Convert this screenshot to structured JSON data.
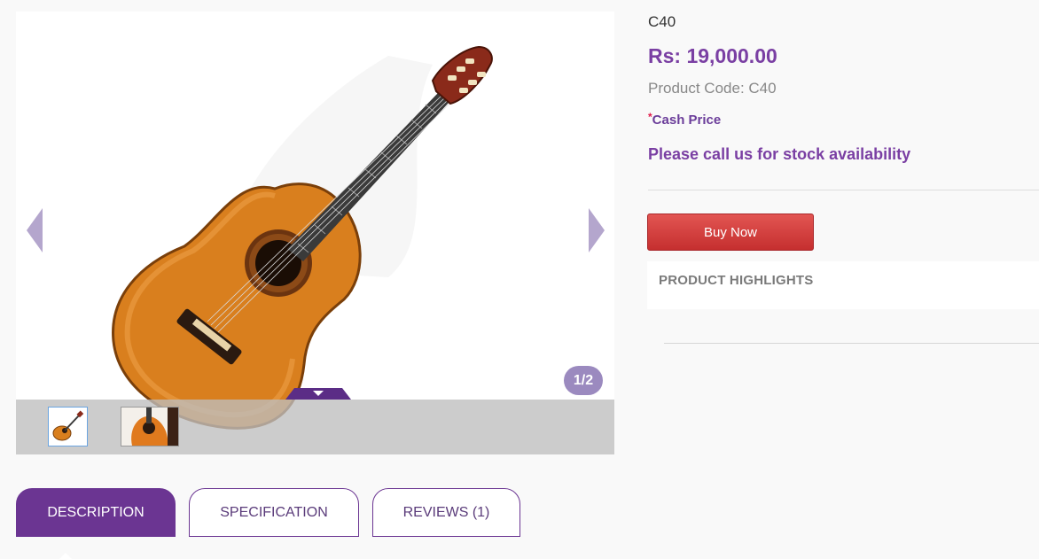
{
  "product": {
    "name": "C40",
    "price": "Rs: 19,000.00",
    "code": "Product Code: C40",
    "cash_marker": "*",
    "cash_label": "Cash Price",
    "stock_message": "Please call us for stock availability",
    "buy_label": "Buy Now",
    "highlights_title": "PRODUCT HIGHLIGHTS"
  },
  "gallery": {
    "counter": "1/2",
    "current_image": 1,
    "total_images": 2
  },
  "tabs": [
    {
      "label": "DESCRIPTION",
      "active": true
    },
    {
      "label": "SPECIFICATION",
      "active": false
    },
    {
      "label": "REVIEWS (1)",
      "active": false
    }
  ],
  "colors": {
    "brand_purple": "#7a3fa3",
    "tab_purple": "#6b3592",
    "buy_red": "#d43f3d",
    "arrow_lavender": "#b4a6cd",
    "counter_bg": "#9b8abf"
  },
  "icons": {
    "prev": "chevron-left-icon",
    "next": "chevron-right-icon",
    "thumbs_toggle": "caret-down-icon"
  }
}
